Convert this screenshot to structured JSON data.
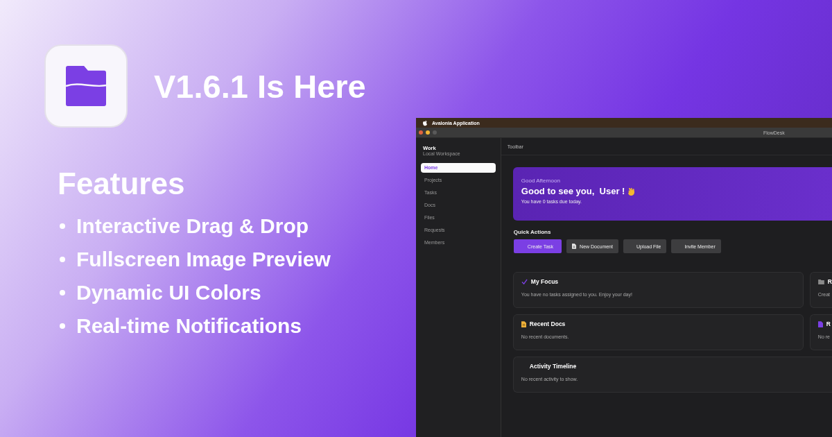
{
  "promo": {
    "title": "V1.6.1 Is Here",
    "features_heading": "Features",
    "features": [
      "Interactive Drag & Drop",
      "Fullscreen Image Preview",
      "Dynamic UI Colors",
      "Real-time Notifications"
    ]
  },
  "menu_bar": {
    "app_name": "Avalonia Application"
  },
  "window": {
    "title": "FlowDesk"
  },
  "sidebar": {
    "workspace": "Work",
    "subtitle": "Local Workspace",
    "items": [
      {
        "label": "Home",
        "selected": true
      },
      {
        "label": "Projects",
        "selected": false
      },
      {
        "label": "Tasks",
        "selected": false
      },
      {
        "label": "Docs",
        "selected": false
      },
      {
        "label": "Files",
        "selected": false
      },
      {
        "label": "Requests",
        "selected": false
      },
      {
        "label": "Members",
        "selected": false
      }
    ]
  },
  "toolbar": {
    "label": "Toolbar"
  },
  "hero": {
    "eyebrow": "Good Afternoon",
    "heading": "Good to see you,  User !",
    "subtitle": "You have 0 tasks due today."
  },
  "quick_actions": {
    "heading": "Quick Actions",
    "buttons": [
      {
        "label": "Create Task",
        "kind": "primary"
      },
      {
        "label": "New Document",
        "kind": "secondary"
      },
      {
        "label": "Upload File",
        "kind": "secondary"
      },
      {
        "label": "Invite Member",
        "kind": "secondary"
      }
    ]
  },
  "cards": [
    {
      "title": "My Focus",
      "text": "You have no tasks assigned to you. Enjoy your day!",
      "kind": "half"
    },
    {
      "title": "R",
      "text": "Creat",
      "kind": "edge"
    },
    {
      "title": "Recent Docs",
      "text": "No recent documents.",
      "kind": "half"
    },
    {
      "title": "R",
      "text": "No re",
      "kind": "edge"
    },
    {
      "title": "Activity Timeline",
      "text": "No recent activity to show.",
      "kind": "wide"
    }
  ]
}
